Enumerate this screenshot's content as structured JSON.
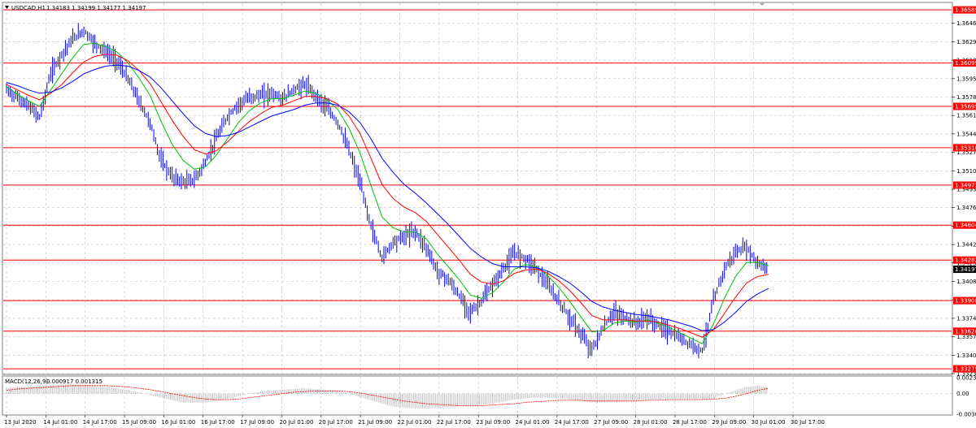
{
  "header": {
    "symbol_title": "USDCAD,H1",
    "ohlc_text": "1.34183 1.34199 1.34177 1.34197"
  },
  "indicator": {
    "title": "MACD(12,26,9)",
    "values_text": "0.000917 0.001315"
  },
  "colors": {
    "price": "#0000ff",
    "ma_fast": "#00c000",
    "ma_mid": "#ff0000",
    "ma_slow": "#0000ff",
    "level": "#ff0000",
    "level_tag": "#ff0000",
    "current_tag": "#000000",
    "grid": "#c0c0c0",
    "macd_hist": "#c0c0c0",
    "macd_signal": "#ff0000"
  },
  "chart_data": {
    "type": "line",
    "title": "USDCAD,H1",
    "ylim": [
      1.33235,
      1.3665
    ],
    "y_ticks": [
      "1.36465",
      "1.36295",
      "1.36125",
      "1.35955",
      "1.35785",
      "1.35615",
      "1.35445",
      "1.35275",
      "1.35105",
      "1.34935",
      "1.34765",
      "1.34595",
      "1.34425",
      "1.34255",
      "1.34085",
      "1.33915",
      "1.33745",
      "1.33575",
      "1.33405",
      "1.33235"
    ],
    "x_ticks": [
      "13 Jul 2020",
      "14 Jul 01:00",
      "14 Jul 17:00",
      "15 Jul 09:00",
      "16 Jul 01:00",
      "16 Jul 17:00",
      "17 Jul 09:00",
      "20 Jul 01:00",
      "20 Jul 17:00",
      "21 Jul 09:00",
      "22 Jul 01:00",
      "22 Jul 17:00",
      "23 Jul 09:00",
      "24 Jul 01:00",
      "24 Jul 17:00",
      "27 Jul 09:00",
      "28 Jul 01:00",
      "28 Jul 17:00",
      "29 Jul 09:00",
      "30 Jul 01:00",
      "30 Jul 17:00"
    ],
    "horizontal_levels": [
      "1.36589",
      "1.36099",
      "1.35699",
      "1.35318",
      "1.34973",
      "1.34604",
      "1.34282",
      "1.33908",
      "1.33626",
      "1.33279"
    ],
    "current_price": "1.34197",
    "series": [
      {
        "values": [
          1.3585,
          1.3578,
          1.357,
          1.356,
          1.36,
          1.3618,
          1.3632,
          1.364,
          1.3628,
          1.362,
          1.3612,
          1.3595,
          1.3575,
          1.3555,
          1.352,
          1.3505,
          1.35,
          1.3502,
          1.3518,
          1.354,
          1.356,
          1.3572,
          1.3578,
          1.358,
          1.3582,
          1.3577,
          1.3585,
          1.359,
          1.358,
          1.3568,
          1.3555,
          1.353,
          1.35,
          1.346,
          1.343,
          1.3445,
          1.345,
          1.3455,
          1.344,
          1.3418,
          1.341,
          1.3395,
          1.338,
          1.339,
          1.3405,
          1.342,
          1.3435,
          1.343,
          1.342,
          1.3405,
          1.339,
          1.3375,
          1.336,
          1.3345,
          1.3365,
          1.338,
          1.3375,
          1.337,
          1.3375,
          1.3368,
          1.3362,
          1.3356,
          1.335,
          1.3345,
          1.339,
          1.342,
          1.3435,
          1.344,
          1.3425,
          1.342
        ]
      },
      {
        "values": [
          1.3588,
          1.3581,
          1.3575,
          1.357,
          1.3585,
          1.36,
          1.3615,
          1.3627,
          1.3628,
          1.3625,
          1.362,
          1.361,
          1.3596,
          1.358,
          1.3556,
          1.3535,
          1.352,
          1.3512,
          1.3514,
          1.3525,
          1.354,
          1.3555,
          1.3566,
          1.3573,
          1.3577,
          1.3577,
          1.358,
          1.3584,
          1.3582,
          1.3576,
          1.3567,
          1.355,
          1.3527,
          1.3497,
          1.3468,
          1.3458,
          1.3454,
          1.3454,
          1.3448,
          1.3434,
          1.3422,
          1.341,
          1.3396,
          1.3393,
          1.3398,
          1.3408,
          1.342,
          1.3424,
          1.3422,
          1.3414,
          1.3403,
          1.339,
          1.3376,
          1.3362,
          1.3363,
          1.337,
          1.3372,
          1.3371,
          1.3373,
          1.337,
          1.3366,
          1.3361,
          1.3356,
          1.3351,
          1.3369,
          1.3393,
          1.3413,
          1.3426,
          1.3426,
          1.3423
        ]
      },
      {
        "values": [
          1.359,
          1.3585,
          1.358,
          1.3576,
          1.3582,
          1.359,
          1.3601,
          1.3611,
          1.3616,
          1.3618,
          1.3617,
          1.3612,
          1.3603,
          1.3591,
          1.3574,
          1.3557,
          1.3542,
          1.353,
          1.3526,
          1.3529,
          1.3537,
          1.3547,
          1.3556,
          1.3563,
          1.3569,
          1.3571,
          1.3575,
          1.3579,
          1.3579,
          1.3577,
          1.3572,
          1.3561,
          1.3545,
          1.3522,
          1.3498,
          1.3485,
          1.3477,
          1.3472,
          1.3464,
          1.3452,
          1.344,
          1.3428,
          1.3415,
          1.3408,
          1.3406,
          1.3409,
          1.3416,
          1.3419,
          1.342,
          1.3416,
          1.3409,
          1.34,
          1.3389,
          1.3377,
          1.3373,
          1.3373,
          1.3373,
          1.3372,
          1.3372,
          1.3371,
          1.3368,
          1.3365,
          1.3361,
          1.3357,
          1.3364,
          1.3379,
          1.3394,
          1.3407,
          1.3413,
          1.3415
        ]
      },
      {
        "values": [
          1.3592,
          1.3589,
          1.3585,
          1.3582,
          1.3583,
          1.3587,
          1.3593,
          1.36,
          1.3604,
          1.3607,
          1.3608,
          1.3607,
          1.3603,
          1.3597,
          1.3587,
          1.3575,
          1.3563,
          1.3552,
          1.3545,
          1.3542,
          1.3543,
          1.3546,
          1.3551,
          1.3556,
          1.3561,
          1.3564,
          1.3567,
          1.3571,
          1.3573,
          1.3573,
          1.3571,
          1.3565,
          1.3555,
          1.354,
          1.3522,
          1.3509,
          1.3498,
          1.349,
          1.3481,
          1.3471,
          1.3461,
          1.345,
          1.3439,
          1.3431,
          1.3425,
          1.3422,
          1.3422,
          1.3422,
          1.3421,
          1.3418,
          1.3413,
          1.3407,
          1.3399,
          1.339,
          1.3385,
          1.3382,
          1.338,
          1.3378,
          1.3377,
          1.3375,
          1.3373,
          1.337,
          1.3367,
          1.3363,
          1.3364,
          1.3371,
          1.338,
          1.339,
          1.3397,
          1.3402
        ]
      }
    ],
    "macd_ylim": [
      -0.00307,
      0.00239
    ],
    "macd_ticks": [
      "0.00239",
      "0.00",
      "-0.00307"
    ],
    "macd_histogram": [
      0.0008,
      0.001,
      0.0011,
      0.0012,
      0.0013,
      0.0014,
      0.0014,
      0.0013,
      0.0012,
      0.001,
      0.0008,
      0.0005,
      0.0002,
      -0.0002,
      -0.0006,
      -0.001,
      -0.0013,
      -0.0014,
      -0.0013,
      -0.0011,
      -0.0008,
      -0.0004,
      0.0,
      0.0003,
      0.0005,
      0.0006,
      0.0007,
      0.0008,
      0.0007,
      0.0006,
      0.0004,
      0.0,
      -0.0005,
      -0.001,
      -0.0015,
      -0.0019,
      -0.0021,
      -0.0022,
      -0.0022,
      -0.0021,
      -0.002,
      -0.0019,
      -0.0018,
      -0.0017,
      -0.0015,
      -0.0012,
      -0.0009,
      -0.0007,
      -0.0006,
      -0.0006,
      -0.0007,
      -0.0009,
      -0.0011,
      -0.0013,
      -0.0013,
      -0.0012,
      -0.0011,
      -0.001,
      -0.0009,
      -0.0008,
      -0.0008,
      -0.0008,
      -0.0008,
      -0.0009,
      -0.0006,
      -0.0001,
      0.0005,
      0.001,
      0.0012,
      0.0009
    ],
    "macd_signal": [
      0.0005,
      0.0007,
      0.0008,
      0.0009,
      0.001,
      0.0011,
      0.0012,
      0.0012,
      0.0012,
      0.0012,
      0.0011,
      0.001,
      0.0008,
      0.0006,
      0.0003,
      0.0,
      -0.0003,
      -0.0006,
      -0.0008,
      -0.0009,
      -0.0009,
      -0.0008,
      -0.0006,
      -0.0004,
      -0.0002,
      0.0,
      0.0002,
      0.0003,
      0.0004,
      0.0004,
      0.0004,
      0.0003,
      0.0001,
      -0.0002,
      -0.0005,
      -0.0008,
      -0.0011,
      -0.0013,
      -0.0015,
      -0.0016,
      -0.0017,
      -0.0018,
      -0.0018,
      -0.0018,
      -0.0017,
      -0.0016,
      -0.0015,
      -0.0013,
      -0.0012,
      -0.0011,
      -0.001,
      -0.001,
      -0.001,
      -0.0011,
      -0.0011,
      -0.0011,
      -0.0011,
      -0.0011,
      -0.001,
      -0.001,
      -0.0009,
      -0.0009,
      -0.0009,
      -0.0009,
      -0.0008,
      -0.0007,
      -0.0004,
      0.0,
      0.0005,
      0.0008
    ]
  }
}
